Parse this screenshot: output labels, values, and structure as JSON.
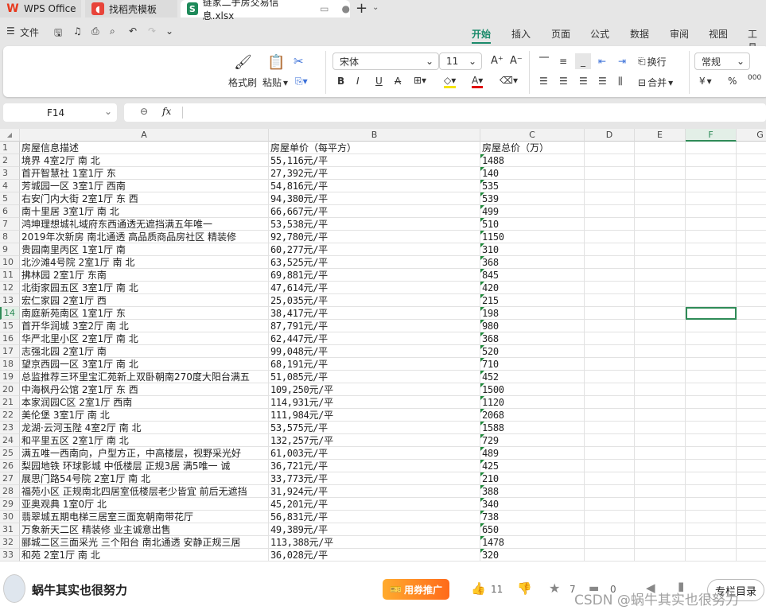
{
  "tabs": [
    {
      "label": "WPS Office"
    },
    {
      "label": "找稻壳模板"
    },
    {
      "label": "链家二手房交易信息.xlsx"
    }
  ],
  "toolbar": {
    "file": "文件"
  },
  "menu": [
    "开始",
    "插入",
    "页面",
    "公式",
    "数据",
    "审阅",
    "视图",
    "工具"
  ],
  "ribbon": {
    "format_painter": "格式刷",
    "paste": "粘贴",
    "font": "宋体",
    "size": "11",
    "wrap": "换行",
    "merge": "合并",
    "number_format": "常规",
    "currency": "¥",
    "percent": "%"
  },
  "colors": {
    "accent": "#1a8a6a",
    "highlight": "#f5e400",
    "font_color": "#e00000"
  },
  "formula_bar": {
    "cell_ref": "F14",
    "fx": "fx",
    "value": ""
  },
  "columns": [
    "A",
    "B",
    "C",
    "D",
    "E",
    "F",
    "G"
  ],
  "selected_cell": "F14",
  "rows": [
    [
      "房屋信息描述",
      "房屋单价（每平方）",
      "房屋总价（万）"
    ],
    [
      "境界 4室2厅 南 北",
      "55,116元/平",
      "1488"
    ],
    [
      "首开智慧社 1室1厅 东",
      "27,392元/平",
      "140"
    ],
    [
      "芳城园一区 3室1厅 西南",
      "54,816元/平",
      "535"
    ],
    [
      "右安门内大街 2室1厅 东 西",
      "94,380元/平",
      "539"
    ],
    [
      "南十里居 3室1厅 南 北",
      "66,667元/平",
      "499"
    ],
    [
      "鸿坤理想城礼域府东西通透无遮挡满五年唯一",
      "53,538元/平",
      "510"
    ],
    [
      "2019年次新房 南北通透  高品质商品房社区 精装修",
      "92,780元/平",
      "1150"
    ],
    [
      "贵园南里丙区 1室1厅 南",
      "60,277元/平",
      "310"
    ],
    [
      "北沙滩4号院 2室1厅 南 北",
      "63,525元/平",
      "368"
    ],
    [
      "拂林园 2室1厅 东南",
      "69,881元/平",
      "845"
    ],
    [
      "北街家园五区 3室1厅 南 北",
      "47,614元/平",
      "420"
    ],
    [
      "宏仁家园 2室1厅 西",
      "25,035元/平",
      "215"
    ],
    [
      "南庭新苑南区 1室1厅 东",
      "38,417元/平",
      "198"
    ],
    [
      "首开华润城 3室2厅 南 北",
      "87,791元/平",
      "980"
    ],
    [
      "华严北里小区 2室1厅 南 北",
      "62,447元/平",
      "368"
    ],
    [
      "志强北园 2室1厅 南",
      "99,048元/平",
      "520"
    ],
    [
      "望京西园一区 3室1厅 南 北",
      "68,191元/平",
      "710"
    ],
    [
      "总监推荐三环里宝汇苑新上双卧朝南270度大阳台满五",
      "51,085元/平",
      "452"
    ],
    [
      "中海枫丹公馆 2室1厅 东 西",
      "109,250元/平",
      "1500"
    ],
    [
      "本家润园C区 2室1厅 西南",
      "114,931元/平",
      "1120"
    ],
    [
      "美伦堡 3室1厅 南 北",
      "111,984元/平",
      "2068"
    ],
    [
      "龙湖·云河玉陛 4室2厅 南 北",
      "53,575元/平",
      "1588"
    ],
    [
      "和平里五区 2室1厅 南 北",
      "132,257元/平",
      "729"
    ],
    [
      "满五唯一西南向，户型方正，中高楼层，视野采光好",
      "61,003元/平",
      "489"
    ],
    [
      "梨园地铁 环球影城 中低楼层 正规3居  满5唯一 诚",
      "36,721元/平",
      "425"
    ],
    [
      "展思门路54号院 2室1厅 南 北",
      "33,773元/平",
      "210"
    ],
    [
      "福苑小区 正规南北四居室低楼层老少皆宜 前后无遮挡",
      "31,924元/平",
      "388"
    ],
    [
      "亚奥观典 1室0厅 北",
      "45,201元/平",
      "340"
    ],
    [
      "翡翠城五期电梯三居室三面宽朝南带花厅",
      "56,831元/平",
      "738"
    ],
    [
      "万象新天二区 精装修 业主诚意出售",
      "49,389元/平",
      "650"
    ],
    [
      "郦城二区三面采光 三个阳台 南北通透 安静正规三居",
      "113,388元/平",
      "1478"
    ],
    [
      "和苑 2室1厅 南 北",
      "36,028元/平",
      "320"
    ]
  ],
  "footer": {
    "author": "蜗牛其实也很努力",
    "promo": "用券推广",
    "likes": "11",
    "stars": "7",
    "comments": "0",
    "catalog": "专栏目录",
    "watermark": "CSDN @蜗牛其实也很努力"
  }
}
